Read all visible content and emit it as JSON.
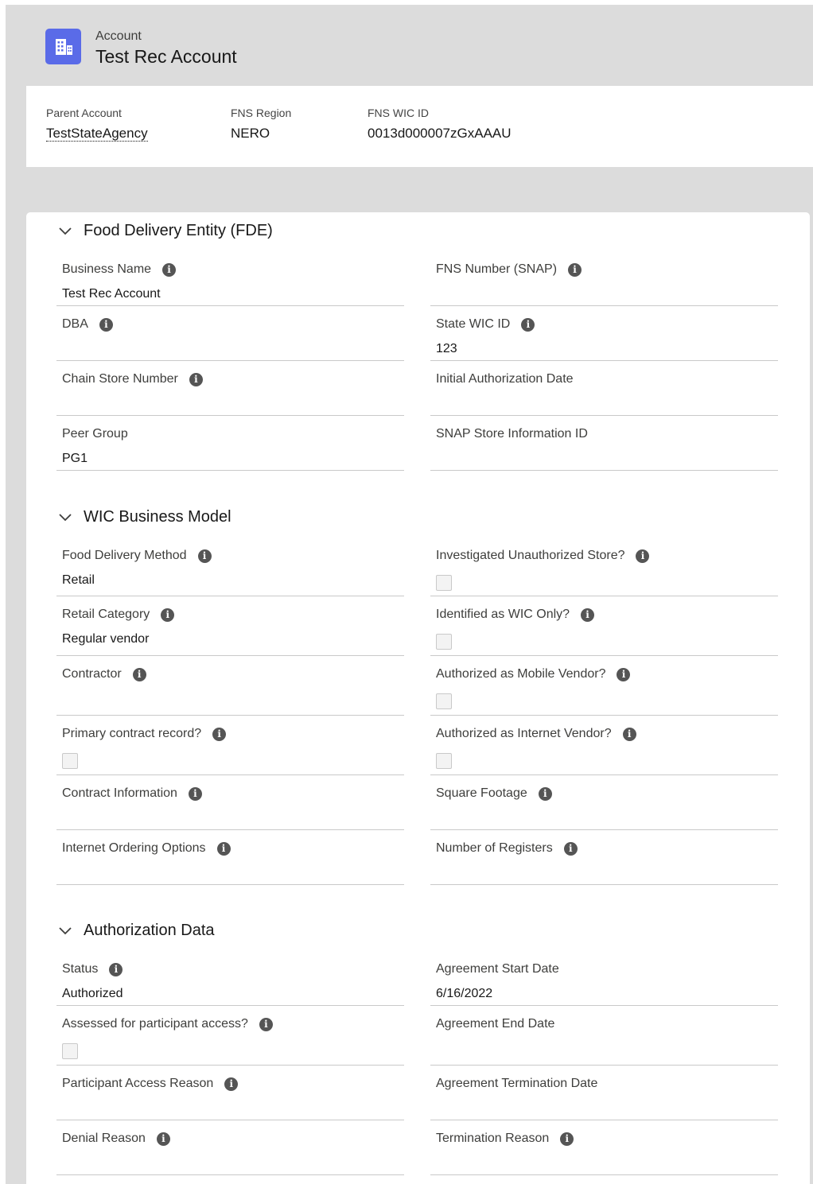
{
  "header": {
    "object_type": "Account",
    "record_name": "Test Rec Account",
    "icon": "account-building-icon",
    "icon_color": "#5a6be8"
  },
  "highlights": [
    {
      "label": "Parent Account",
      "value": "TestStateAgency",
      "link": true
    },
    {
      "label": "FNS Region",
      "value": "NERO",
      "link": false
    },
    {
      "label": "FNS WIC ID",
      "value": "0013d000007zGxAAAU",
      "link": false
    }
  ],
  "sections": [
    {
      "title": "Food Delivery Entity (FDE)",
      "fields": [
        {
          "label": "Business Name",
          "value": "Test Rec Account",
          "info": true,
          "type": "text"
        },
        {
          "label": "FNS Number (SNAP)",
          "value": "",
          "info": true,
          "type": "text"
        },
        {
          "label": "DBA",
          "value": "",
          "info": true,
          "type": "text"
        },
        {
          "label": "State WIC ID",
          "value": "123",
          "info": true,
          "type": "text"
        },
        {
          "label": "Chain Store Number",
          "value": "",
          "info": true,
          "type": "text"
        },
        {
          "label": "Initial Authorization Date",
          "value": "",
          "info": false,
          "type": "text"
        },
        {
          "label": "Peer Group",
          "value": "PG1",
          "info": false,
          "type": "text"
        },
        {
          "label": "SNAP Store Information ID",
          "value": "",
          "info": false,
          "type": "text"
        }
      ]
    },
    {
      "title": "WIC Business Model",
      "fields": [
        {
          "label": "Food Delivery Method",
          "value": "Retail",
          "info": true,
          "type": "text"
        },
        {
          "label": "Investigated Unauthorized Store?",
          "value": "",
          "info": true,
          "type": "checkbox"
        },
        {
          "label": "Retail Category",
          "value": "Regular vendor",
          "info": true,
          "type": "text"
        },
        {
          "label": "Identified as WIC Only?",
          "value": "",
          "info": true,
          "type": "checkbox"
        },
        {
          "label": "Contractor",
          "value": "",
          "info": true,
          "type": "text"
        },
        {
          "label": "Authorized as Mobile Vendor?",
          "value": "",
          "info": true,
          "type": "checkbox"
        },
        {
          "label": "Primary contract record?",
          "value": "",
          "info": true,
          "type": "checkbox"
        },
        {
          "label": "Authorized as Internet Vendor?",
          "value": "",
          "info": true,
          "type": "checkbox"
        },
        {
          "label": "Contract Information",
          "value": "",
          "info": true,
          "type": "text"
        },
        {
          "label": "Square Footage",
          "value": "",
          "info": true,
          "type": "text"
        },
        {
          "label": "Internet Ordering Options",
          "value": "",
          "info": true,
          "type": "text"
        },
        {
          "label": "Number of Registers",
          "value": "",
          "info": true,
          "type": "text"
        }
      ]
    },
    {
      "title": "Authorization Data",
      "fields": [
        {
          "label": "Status",
          "value": "Authorized",
          "info": true,
          "type": "text"
        },
        {
          "label": "Agreement Start Date",
          "value": "6/16/2022",
          "info": false,
          "type": "text"
        },
        {
          "label": "Assessed for participant access?",
          "value": "",
          "info": true,
          "type": "checkbox"
        },
        {
          "label": "Agreement End Date",
          "value": "",
          "info": false,
          "type": "text"
        },
        {
          "label": "Participant Access Reason",
          "value": "",
          "info": true,
          "type": "text"
        },
        {
          "label": "Agreement Termination Date",
          "value": "",
          "info": false,
          "type": "text"
        },
        {
          "label": "Denial Reason",
          "value": "",
          "info": true,
          "type": "text"
        },
        {
          "label": "Termination Reason",
          "value": "",
          "info": true,
          "type": "text"
        }
      ]
    }
  ]
}
